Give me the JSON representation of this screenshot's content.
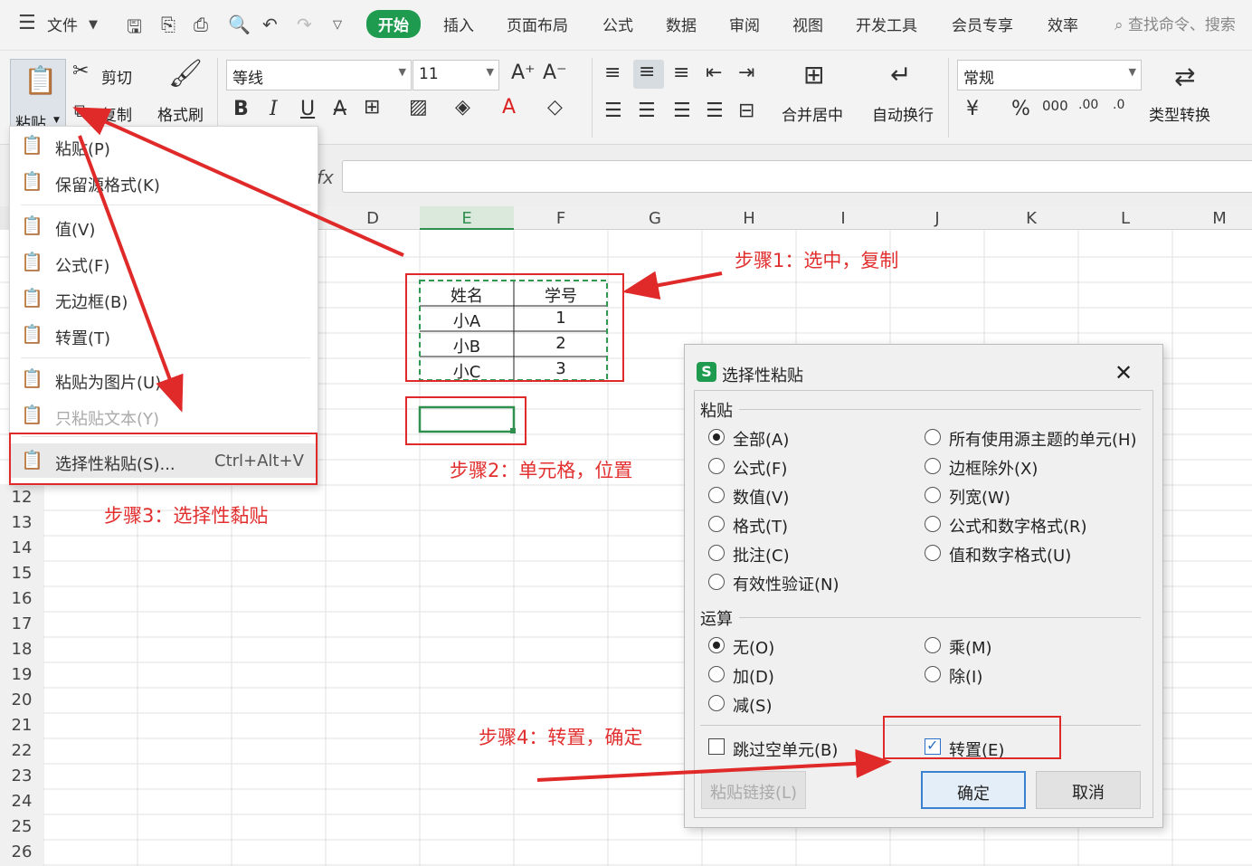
{
  "menubar": {
    "file": "文件",
    "tabs": [
      "开始",
      "插入",
      "页面布局",
      "公式",
      "数据",
      "审阅",
      "视图",
      "开发工具",
      "会员专享",
      "效率"
    ],
    "search_placeholder": "查找命令、搜索"
  },
  "ribbon": {
    "paste": "粘贴",
    "cut": "剪切",
    "copy": "复制",
    "format_painter": "格式刷",
    "font_name": "等线",
    "font_size": "11",
    "merge_center": "合并居中",
    "auto_wrap": "自动换行",
    "number_format": "常规",
    "type_convert": "类型转换",
    "bold": "B",
    "italic": "I",
    "underline": "U"
  },
  "grid": {
    "columns": [
      "D",
      "E",
      "F",
      "G",
      "H",
      "I",
      "J",
      "K",
      "L",
      "M"
    ],
    "selected_column": "E",
    "rows": [
      "12",
      "13",
      "14",
      "15",
      "16",
      "17",
      "18",
      "19",
      "20",
      "21",
      "22",
      "23",
      "24",
      "25",
      "26"
    ],
    "table": {
      "headers": [
        "姓名",
        "学号"
      ],
      "rows": [
        [
          "小A",
          "1"
        ],
        [
          "小B",
          "2"
        ],
        [
          "小C",
          "3"
        ]
      ]
    }
  },
  "paste_menu": {
    "items": [
      {
        "label": "粘贴(P)",
        "icon": "clipboard-icon"
      },
      {
        "label": "保留源格式(K)",
        "icon": "clipboard-format-icon"
      },
      {
        "label": "值(V)",
        "icon": "clipboard-123-icon"
      },
      {
        "label": "公式(F)",
        "icon": "clipboard-fx-icon"
      },
      {
        "label": "无边框(B)",
        "icon": "clipboard-noborder-icon"
      },
      {
        "label": "转置(T)",
        "icon": "clipboard-transpose-icon"
      },
      {
        "label": "粘贴为图片(U)",
        "icon": "clipboard-image-icon"
      },
      {
        "label": "只粘贴文本(Y)",
        "icon": "clipboard-text-icon"
      },
      {
        "label": "选择性粘贴(S)...",
        "shortcut": "Ctrl+Alt+V",
        "icon": "clipboard-special-icon"
      }
    ]
  },
  "dialog": {
    "title": "选择性粘贴",
    "paste_section": "粘贴",
    "paste_options_left": [
      "全部(A)",
      "公式(F)",
      "数值(V)",
      "格式(T)",
      "批注(C)",
      "有效性验证(N)"
    ],
    "paste_options_right": [
      "所有使用源主题的单元(H)",
      "边框除外(X)",
      "列宽(W)",
      "公式和数字格式(R)",
      "值和数字格式(U)"
    ],
    "paste_selected": "全部(A)",
    "operation_section": "运算",
    "operation_left": [
      "无(O)",
      "加(D)",
      "减(S)"
    ],
    "operation_right": [
      "乘(M)",
      "除(I)"
    ],
    "operation_selected": "无(O)",
    "skip_blanks": "跳过空单元(B)",
    "transpose": "转置(E)",
    "transpose_checked": true,
    "paste_link": "粘贴链接(L)",
    "ok": "确定",
    "cancel": "取消"
  },
  "annotations": {
    "step1": "步骤1：选中，复制",
    "step2": "步骤2：单元格，位置",
    "step3": "步骤3：选择性黏贴",
    "step4": "步骤4：转置，确定"
  },
  "colors": {
    "accent_green": "#1e9b4f",
    "annotation_red": "#e02a2a"
  }
}
